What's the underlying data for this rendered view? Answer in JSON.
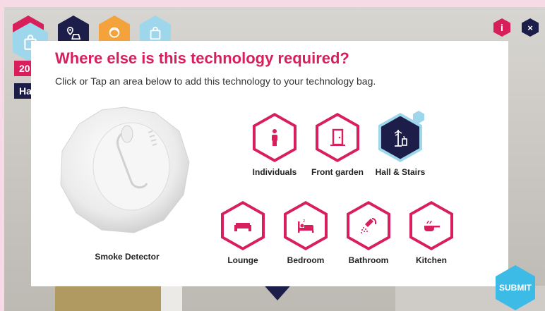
{
  "colors": {
    "accent": "#d81e5b",
    "navy": "#1c1d49",
    "light_blue": "#9ed6ec",
    "orange": "#f3a23c",
    "submit_blue": "#3bbbe5"
  },
  "side_tags": {
    "year": "20",
    "room": "Ha"
  },
  "top_menu": {
    "icons": [
      "shopping-bag-icon",
      "map-pin-icon",
      "person-icon",
      "shopping-bag-icon"
    ]
  },
  "top_right": {
    "info_label": "i",
    "close_label": "×"
  },
  "modal": {
    "title": "Where else is this technology required?",
    "subtitle": "Click or Tap an area below to add this technology to your technology bag.",
    "item_label": "Smoke Detector"
  },
  "areas_row1": [
    {
      "label": "Individuals",
      "icon": "person-icon",
      "selected": false
    },
    {
      "label": "Front garden",
      "icon": "door-icon",
      "selected": false
    },
    {
      "label": "Hall & Stairs",
      "icon": "coat-stand-icon",
      "selected": true
    }
  ],
  "areas_row2": [
    {
      "label": "Lounge",
      "icon": "sofa-icon",
      "selected": false
    },
    {
      "label": "Bedroom",
      "icon": "bed-icon",
      "selected": false
    },
    {
      "label": "Bathroom",
      "icon": "shower-icon",
      "selected": false
    },
    {
      "label": "Kitchen",
      "icon": "pan-icon",
      "selected": false
    }
  ],
  "submit_label": "SUBMIT"
}
